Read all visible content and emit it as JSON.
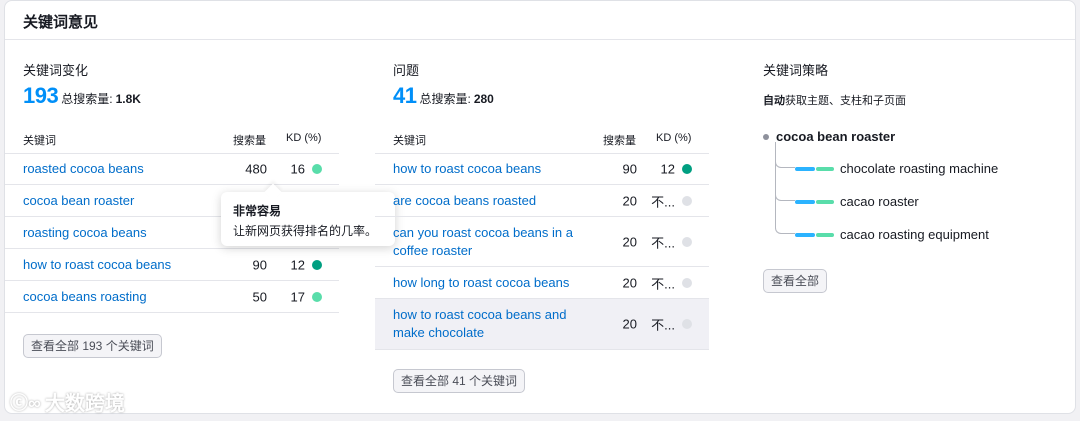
{
  "card": {
    "title": "关键词意见"
  },
  "variations": {
    "title": "关键词变化",
    "count": "193",
    "volume_label": "总搜索量:",
    "volume_value": "1.8K",
    "headers": {
      "keyword": "关键词",
      "volume": "搜索量",
      "kd": "KD (%)"
    },
    "rows": [
      {
        "keyword": "roasted cocoa beans",
        "volume": "480",
        "kd": "16",
        "kd_color": "#59ddaa"
      },
      {
        "keyword": "cocoa bean roaster",
        "volume": "",
        "kd": "",
        "kd_color": ""
      },
      {
        "keyword": "roasting cocoa beans",
        "volume": "",
        "kd": "",
        "kd_color": ""
      },
      {
        "keyword": "how to roast cocoa beans",
        "volume": "90",
        "kd": "12",
        "kd_color": "#009f81"
      },
      {
        "keyword": "cocoa beans roasting",
        "volume": "50",
        "kd": "17",
        "kd_color": "#59ddaa"
      }
    ],
    "view_all": "查看全部 193 个关键词"
  },
  "tooltip": {
    "title": "非常容易",
    "text": "让新网页获得排名的几率。"
  },
  "questions": {
    "title": "问题",
    "count": "41",
    "volume_label": "总搜索量:",
    "volume_value": "280",
    "headers": {
      "keyword": "关键词",
      "volume": "搜索量",
      "kd": "KD (%)"
    },
    "rows": [
      {
        "keyword": "how to roast cocoa beans",
        "volume": "90",
        "kd": "12",
        "kd_color": "#009f81"
      },
      {
        "keyword": "are cocoa beans roasted",
        "volume": "20",
        "kd": "不...",
        "kd_color": "#dfe1e6"
      },
      {
        "keyword": "can you roast cocoa beans in a coffee roaster",
        "volume": "20",
        "kd": "不...",
        "kd_color": "#dfe1e6"
      },
      {
        "keyword": "how long to roast cocoa beans",
        "volume": "20",
        "kd": "不...",
        "kd_color": "#dfe1e6"
      },
      {
        "keyword": "how to roast cocoa beans and make chocolate",
        "volume": "20",
        "kd": "不...",
        "kd_color": "#dfe1e6"
      }
    ],
    "view_all": "查看全部 41 个关键词"
  },
  "strategy": {
    "title": "关键词策略",
    "subtitle_bold": "自动",
    "subtitle_rest": "获取主题、支柱和子页面",
    "root": "cocoa bean roaster",
    "children": [
      "chocolate roasting machine",
      "cacao roaster",
      "cacao roasting equipment"
    ],
    "view_all": "查看全部"
  },
  "watermark": {
    "text": "大数跨境",
    "logo": "ⓒ∞"
  }
}
